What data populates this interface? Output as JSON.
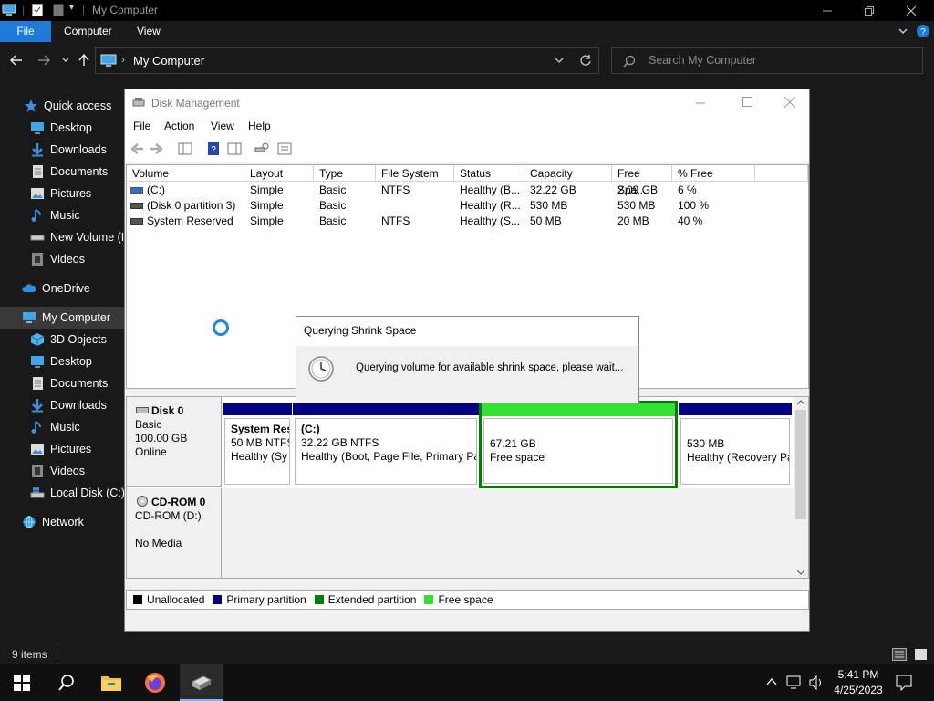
{
  "explorer": {
    "title": "My Computer",
    "ribbon_tabs": [
      "File",
      "Computer",
      "View"
    ],
    "address": "My Computer",
    "search_placeholder": "Search My Computer",
    "status_items": "9 items",
    "sidebar": {
      "quick_access": "Quick access",
      "quick_items": [
        "Desktop",
        "Downloads",
        "Documents",
        "Pictures",
        "Music",
        "New Volume (I:)",
        "Videos"
      ],
      "onedrive": "OneDrive",
      "my_computer": "My Computer",
      "computer_items": [
        "3D Objects",
        "Desktop",
        "Documents",
        "Downloads",
        "Music",
        "Pictures",
        "Videos",
        "Local Disk (C:)"
      ],
      "network": "Network"
    }
  },
  "disk_management": {
    "title": "Disk Management",
    "menu": [
      "File",
      "Action",
      "View",
      "Help"
    ],
    "columns": [
      "Volume",
      "Layout",
      "Type",
      "File System",
      "Status",
      "Capacity",
      "Free Spa...",
      "% Free"
    ],
    "rows": [
      [
        "(C:)",
        "Simple",
        "Basic",
        "NTFS",
        "Healthy (B...",
        "32.22 GB",
        "2.09 GB",
        "6 %"
      ],
      [
        "(Disk 0 partition 3)",
        "Simple",
        "Basic",
        "",
        "Healthy (R...",
        "530 MB",
        "530 MB",
        "100 %"
      ],
      [
        "System Reserved",
        "Simple",
        "Basic",
        "NTFS",
        "Healthy (S...",
        "50 MB",
        "20 MB",
        "40 %"
      ]
    ],
    "disk0": {
      "name": "Disk 0",
      "type": "Basic",
      "size": "100.00 GB",
      "state": "Online",
      "partitions": [
        {
          "title": "System Res",
          "line1": "50 MB NTFS",
          "line2": "Healthy (Sy"
        },
        {
          "title": "(C:)",
          "line1": "32.22 GB NTFS",
          "line2": "Healthy (Boot, Page File, Primary Pa"
        },
        {
          "title": "",
          "line1": "67.21 GB",
          "line2": "Free space"
        },
        {
          "title": "",
          "line1": "530 MB",
          "line2": "Healthy (Recovery Pa"
        }
      ]
    },
    "cdrom0": {
      "name": "CD-ROM 0",
      "drive": "CD-ROM (D:)",
      "media": "No Media"
    },
    "legend": [
      "Unallocated",
      "Primary partition",
      "Extended partition",
      "Free space"
    ],
    "colors": {
      "unallocated": "#000000",
      "primary": "#000080",
      "extended": "#008000",
      "free": "#00ee00"
    }
  },
  "dialog": {
    "title": "Querying Shrink Space",
    "message": "Querying volume for available shrink space, please wait..."
  },
  "taskbar": {
    "time": "5:41 PM",
    "date": "4/25/2023"
  }
}
